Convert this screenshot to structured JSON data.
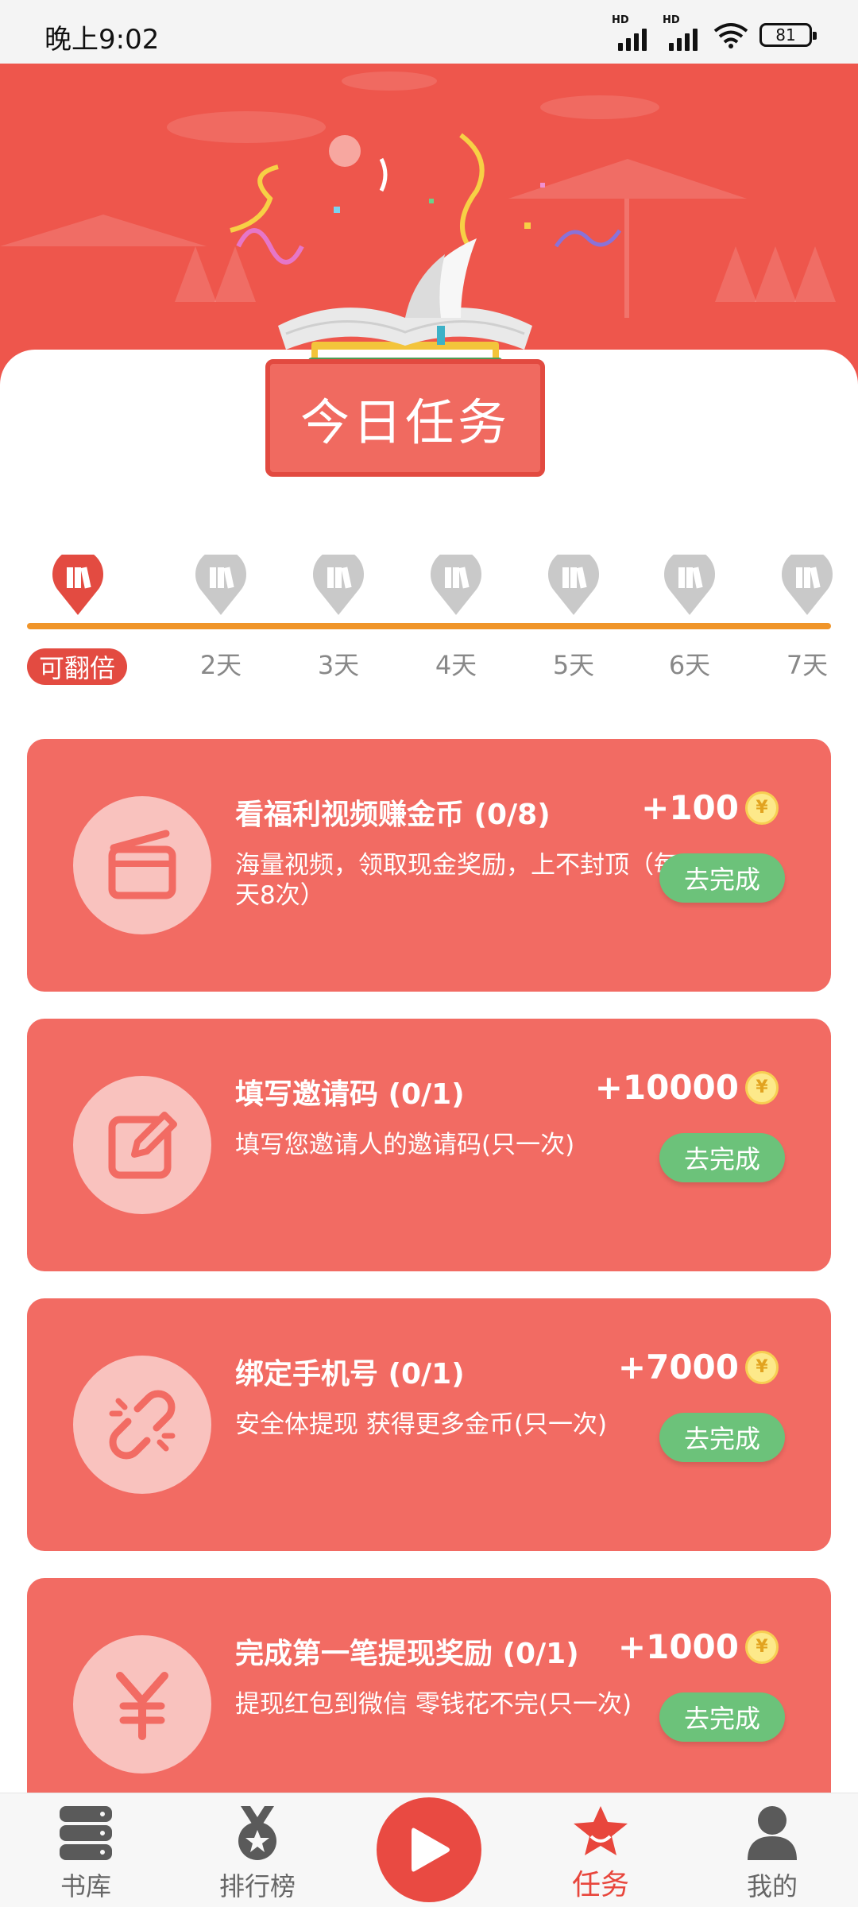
{
  "status_bar": {
    "time": "晚上9:02",
    "battery": "81",
    "hd1": "HD",
    "hd2": "HD"
  },
  "header": {
    "title": "今日任务"
  },
  "streak": {
    "today_label": "可翻倍",
    "days": [
      "2天",
      "3天",
      "4天",
      "5天",
      "6天",
      "7天"
    ]
  },
  "tasks": [
    {
      "title": "看福利视频赚金币 (0/8)",
      "desc": "海量视频，领取现金奖励，上不封顶（每天8次）",
      "reward": "+100",
      "button": "去完成",
      "icon": "video-ticket-icon"
    },
    {
      "title": "填写邀请码 (0/1)",
      "desc": "填写您邀请人的邀请码(只一次)",
      "reward": "+10000",
      "button": "去完成",
      "icon": "edit-icon"
    },
    {
      "title": "绑定手机号 (0/1)",
      "desc": "安全体提现 获得更多金币(只一次)",
      "reward": "+7000",
      "button": "去完成",
      "icon": "broken-link-icon"
    },
    {
      "title": "完成第一笔提现奖励 (0/1)",
      "desc": "提现红包到微信 零钱花不完(只一次)",
      "reward": "+1000",
      "button": "去完成",
      "icon": "yuan-icon"
    }
  ],
  "coin_symbol": "¥",
  "nav": {
    "library": "书库",
    "ranking": "排行榜",
    "tasks": "任务",
    "mine": "我的"
  },
  "colors": {
    "brand_red": "#ee564c",
    "card_red": "#f26b63",
    "button_green": "#6cc27a",
    "track_orange": "#f0952a"
  }
}
